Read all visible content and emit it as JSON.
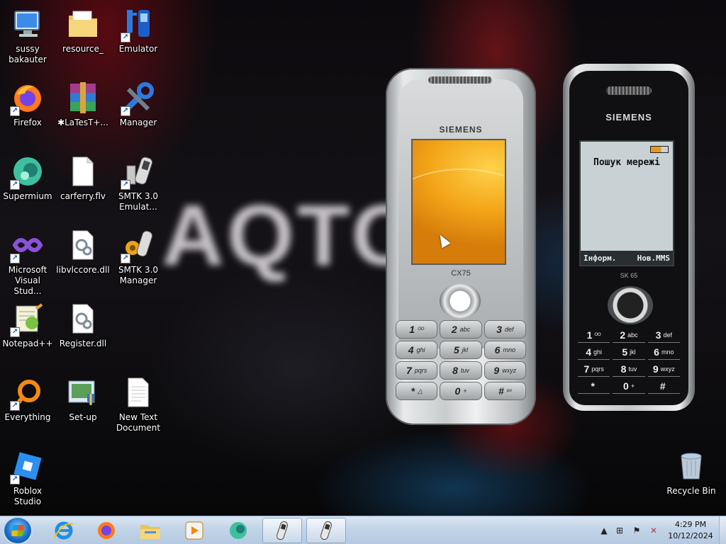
{
  "wallpaper_text": "AQTO",
  "desktop_icons": [
    {
      "label": "sussy bakauter",
      "icon": "computer-icon",
      "shortcut": false
    },
    {
      "label": "resource_",
      "icon": "folder-icon",
      "shortcut": false
    },
    {
      "label": "Emulator",
      "icon": "phone-emulator-icon",
      "shortcut": true
    },
    {
      "label": "Firefox",
      "icon": "firefox-icon",
      "shortcut": true
    },
    {
      "label": "✱LaTesT+...",
      "icon": "winrar-icon",
      "shortcut": false
    },
    {
      "label": "Manager",
      "icon": "manager-tools-icon",
      "shortcut": true
    },
    {
      "label": "Supermium",
      "icon": "supermium-icon",
      "shortcut": true
    },
    {
      "label": "carferry.flv",
      "icon": "file-icon",
      "shortcut": false
    },
    {
      "label": "SMTK 3.0 Emulat...",
      "icon": "smtk-icon",
      "shortcut": true
    },
    {
      "label": "Microsoft Visual Stud...",
      "icon": "visual-studio-icon",
      "shortcut": true
    },
    {
      "label": "libvlccore.dll",
      "icon": "dll-icon",
      "shortcut": false
    },
    {
      "label": "SMTK 3.0 Manager",
      "icon": "smtk-manager-icon",
      "shortcut": true
    },
    {
      "label": "Notepad++",
      "icon": "notepadpp-icon",
      "shortcut": true
    },
    {
      "label": "Register.dll",
      "icon": "dll-icon",
      "shortcut": false
    },
    {
      "label": "Everything",
      "icon": "everything-icon",
      "shortcut": true
    },
    {
      "label": "Set-up",
      "icon": "setup-icon",
      "shortcut": false
    },
    {
      "label": "New Text Document",
      "icon": "text-document-icon",
      "shortcut": false
    },
    {
      "label": "Roblox Studio",
      "icon": "roblox-studio-icon",
      "shortcut": true
    },
    {
      "label": "Recycle Bin",
      "icon": "recycle-bin-icon",
      "shortcut": false
    }
  ],
  "phone_cx75": {
    "brand": "SIEMENS",
    "model": "CX75",
    "keys": [
      {
        "d": "1",
        "s": "ᴼᴼ"
      },
      {
        "d": "2",
        "s": "abc"
      },
      {
        "d": "3",
        "s": "def"
      },
      {
        "d": "4",
        "s": "ghi"
      },
      {
        "d": "5",
        "s": "jkl"
      },
      {
        "d": "6",
        "s": "mno"
      },
      {
        "d": "7",
        "s": "pqrs"
      },
      {
        "d": "8",
        "s": "tuv"
      },
      {
        "d": "9",
        "s": "wxyz"
      },
      {
        "d": "*",
        "s": "△"
      },
      {
        "d": "0",
        "s": "+"
      },
      {
        "d": "#",
        "s": "ᵖᵒ"
      }
    ]
  },
  "phone_sk65": {
    "brand": "SIEMENS",
    "model": "SK 65",
    "screen_title": "Пошук мережі",
    "softkey_left": "Інформ.",
    "softkey_right": "Нов.MMS",
    "keys": [
      {
        "d": "1",
        "s": "ᴼᴼ"
      },
      {
        "d": "2",
        "s": "abc"
      },
      {
        "d": "3",
        "s": "def"
      },
      {
        "d": "4",
        "s": "ghi"
      },
      {
        "d": "5",
        "s": "jkl"
      },
      {
        "d": "6",
        "s": "mno"
      },
      {
        "d": "7",
        "s": "pqrs"
      },
      {
        "d": "8",
        "s": "tuv"
      },
      {
        "d": "9",
        "s": "wxyz"
      },
      {
        "d": "*",
        "s": ""
      },
      {
        "d": "0",
        "s": "+"
      },
      {
        "d": "#",
        "s": ""
      }
    ]
  },
  "taskbar": {
    "pinned": [
      "internet-explorer-icon",
      "firefox-icon",
      "file-explorer-icon",
      "media-player-icon",
      "supermium-icon"
    ],
    "running": [
      "smtk-emulator-window-icon",
      "smtk-emulator-window-icon"
    ],
    "clock_time": "4:29 PM",
    "clock_date": "10/12/2024"
  }
}
